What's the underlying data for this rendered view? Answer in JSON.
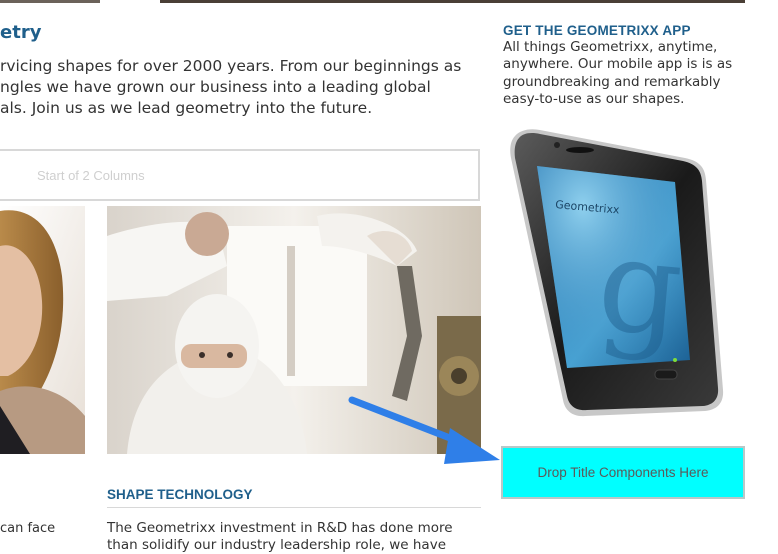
{
  "header": {
    "title": "etry",
    "intro": "rvicing shapes for over 2000 years. From our beginnings as\nngles we have grown our business into a leading global\nals. Join us as we lead geometry into the future."
  },
  "columns": {
    "placeholder_label": "Start of 2 Columns"
  },
  "left_column": {
    "caption": "can face"
  },
  "right_column": {
    "section_title": "SHAPE TECHNOLOGY",
    "body": "The Geometrixx investment in R&D has done more\nthan solidify our industry leadership role, we have"
  },
  "sidebar": {
    "app_title": "GET THE GEOMETRIXX APP",
    "app_text": "All things Geometrixx, anytime,\nanywhere. Our mobile app is is as\ngroundbreaking and remarkably\neasy-to-use as our shapes.",
    "phone_brand": "Geometrixx",
    "drop_zone_label": "Drop Title Components Here"
  },
  "colors": {
    "heading": "#1f5f8b",
    "drop_zone": "#00ffff",
    "arrow": "#2f7fe8"
  }
}
